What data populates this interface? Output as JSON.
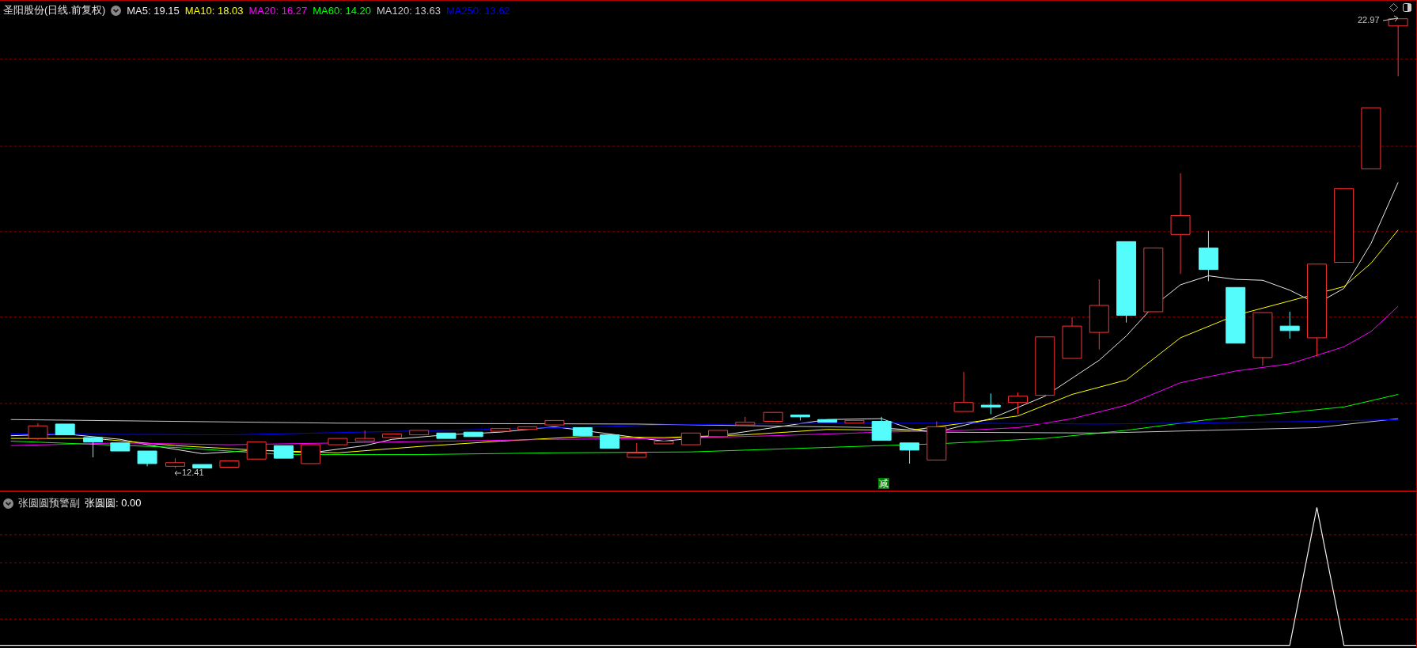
{
  "main_panel": {
    "title": "圣阳股份(日线.前复权)",
    "indicators": [
      {
        "label": "MA5: 19.15",
        "color": "#e8e8e8"
      },
      {
        "label": "MA10: 18.03",
        "color": "#ffff00"
      },
      {
        "label": "MA20: 16.27",
        "color": "#ff00ff"
      },
      {
        "label": "MA60: 14.20",
        "color": "#00ff00"
      },
      {
        "label": "MA120: 13.63",
        "color": "#c8c8c8"
      },
      {
        "label": "MA250: 13.62",
        "color": "#0000ff"
      }
    ],
    "high_label": "22.97",
    "low_label": "12.41",
    "signal_badge": "减"
  },
  "sub_panel": {
    "title": "张圆圆预警副",
    "value": "张圆圆: 0.00"
  }
}
